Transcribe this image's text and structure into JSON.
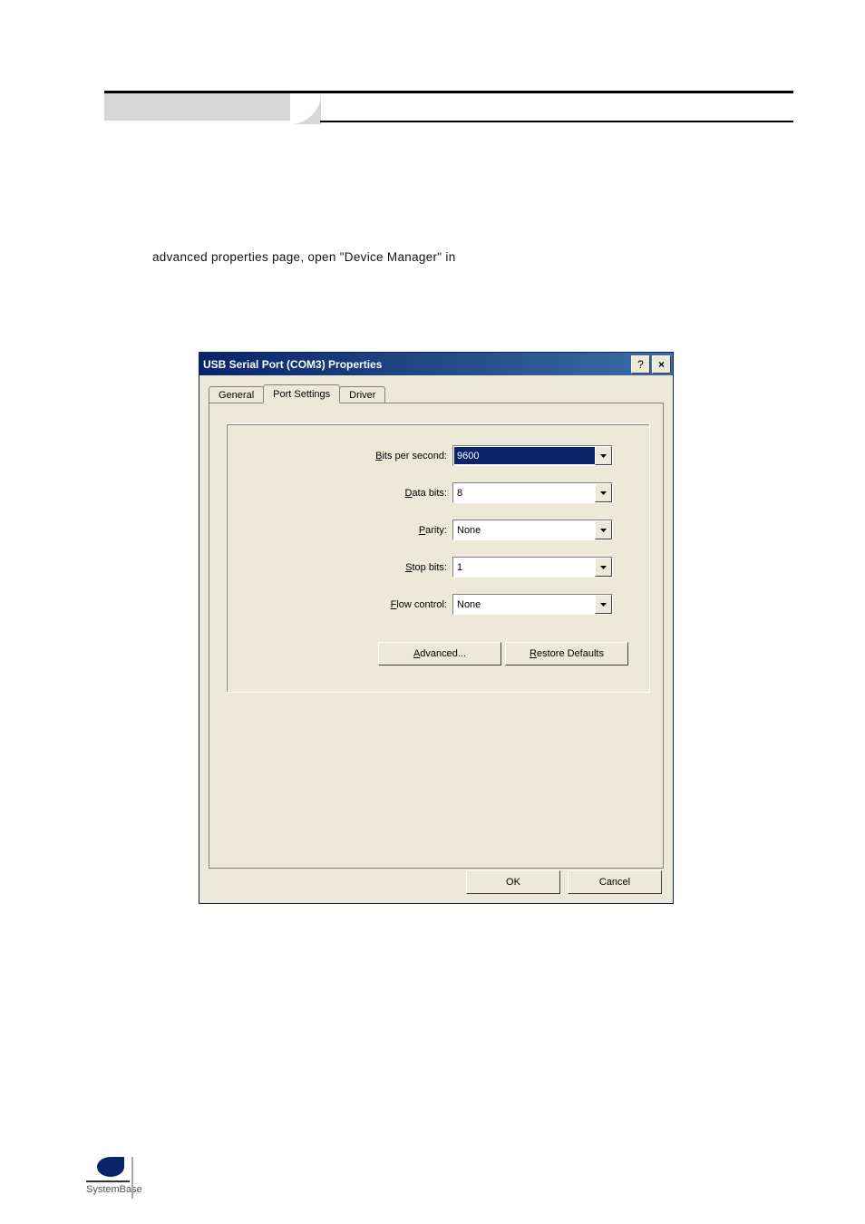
{
  "page": {
    "intro_text": "advanced properties page, open \"Device Manager\" in"
  },
  "dialog": {
    "title": "USB Serial Port (COM3) Properties",
    "help_glyph": "?",
    "close_glyph": "×",
    "tabs": {
      "general": "General",
      "port_settings": "Port Settings",
      "driver": "Driver"
    },
    "fields": {
      "bps_label": "Bits per second:",
      "bps_value": "9600",
      "databits_label": "Data bits:",
      "databits_value": "8",
      "parity_label": "Parity:",
      "parity_value": "None",
      "stopbits_label": "Stop bits:",
      "stopbits_value": "1",
      "flow_label": "Flow control:",
      "flow_value": "None"
    },
    "buttons": {
      "advanced": "Advanced...",
      "restore": "Restore Defaults",
      "ok": "OK",
      "cancel": "Cancel"
    }
  },
  "logo": {
    "text": "SystemBase"
  }
}
